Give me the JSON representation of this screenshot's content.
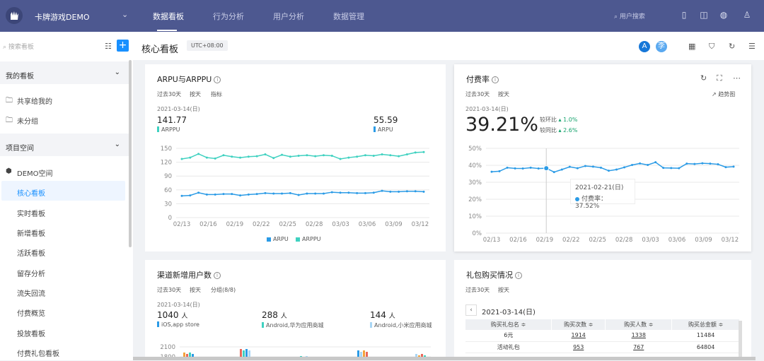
{
  "app": {
    "name": "卡牌游戏DEMO"
  },
  "topnav": {
    "tabs": [
      "数据看板",
      "行为分析",
      "用户分析",
      "数据管理"
    ],
    "search_placeholder": "用户搜索"
  },
  "sidebar": {
    "search_placeholder": "搜索看板",
    "groups": [
      {
        "label": "我的看板"
      },
      {
        "label": "项目空间"
      }
    ],
    "my_items": [
      "共享给我的",
      "未分组"
    ],
    "space_label": "DEMO空间",
    "boards": [
      "核心看板",
      "实时看板",
      "新增看板",
      "活跃看板",
      "留存分析",
      "流失回流",
      "付费概览",
      "投放看板",
      "付费礼包看板"
    ]
  },
  "header": {
    "title": "核心看板",
    "timezone": "UTC+08:00",
    "avatar_a": "A",
    "avatar_b": "李"
  },
  "colors": {
    "topbar": "#4d5890",
    "accent": "#1890ff",
    "arpu": "#2b9be6",
    "arppu": "#3fd1c0",
    "positive": "#13a26b"
  },
  "cards": {
    "arpu": {
      "title": "ARPU与ARPPU",
      "meta": [
        "过去30天",
        "按天",
        "指标"
      ],
      "date": "2021-03-14(日)",
      "val1": "141.77",
      "lab1": "ARPPU",
      "val2": "55.59",
      "lab2": "ARPU",
      "legend": [
        "ARPU",
        "ARPPU"
      ]
    },
    "payrate": {
      "title": "付费率",
      "meta": [
        "过去30天",
        "按天"
      ],
      "trend_label": "趋势图",
      "date": "2021-03-14(日)",
      "value": "39.21%",
      "cmp1_label": "较环比",
      "cmp1_value": "1.0%",
      "cmp2_label": "较同比",
      "cmp2_value": "2.6%",
      "tooltip_date": "2021-02-21(日)",
      "tooltip_label": "付费率：37.52%"
    },
    "channel": {
      "title": "渠道新增用户数",
      "meta": [
        "过去30天",
        "按天",
        "分组(8/8)"
      ],
      "date": "2021-03-14(日)",
      "items": [
        {
          "value": "1040",
          "unit": "人",
          "label": "iOS,app store"
        },
        {
          "value": "288",
          "unit": "人",
          "label": "Android,华为应用商城"
        },
        {
          "value": "144",
          "unit": "人",
          "label": "Android,小米应用商城"
        }
      ]
    },
    "gift": {
      "title": "礼包购买情况",
      "meta": [
        "过去30天",
        "按天"
      ],
      "date": "2021-03-14(日)",
      "headers": [
        "购买礼包名 ≑",
        "购买次数 ≑",
        "购买人数 ≑",
        "购买总金额 ≑"
      ],
      "rows": [
        [
          "6元",
          "1914",
          "1338",
          "11484"
        ],
        [
          "活动礼包",
          "953",
          "767",
          "64804"
        ]
      ]
    }
  },
  "chart_data": [
    {
      "type": "line",
      "title": "ARPU与ARPPU",
      "x_ticks": [
        "02/13",
        "02/16",
        "02/19",
        "02/22",
        "02/25",
        "02/28",
        "03/03",
        "03/06",
        "03/09",
        "03/12"
      ],
      "ylim": [
        0,
        150
      ],
      "y_ticks": [
        "0",
        "30",
        "60",
        "90",
        "120",
        "150"
      ],
      "series": [
        {
          "name": "ARPU",
          "values": [
            47,
            48,
            54,
            50,
            50,
            51,
            51,
            48,
            50,
            51,
            53,
            52,
            52,
            53,
            49,
            52,
            52,
            52,
            55,
            54,
            54,
            53,
            53,
            54,
            58,
            56,
            56,
            57,
            57,
            56
          ]
        },
        {
          "name": "ARPPU",
          "values": [
            127,
            130,
            138,
            130,
            128,
            135,
            132,
            130,
            132,
            133,
            137,
            129,
            136,
            132,
            134,
            135,
            133,
            135,
            134,
            127,
            130,
            132,
            135,
            134,
            137,
            135,
            133,
            137,
            141,
            142
          ]
        }
      ],
      "legend": "bottom"
    },
    {
      "type": "line",
      "title": "付费率",
      "x_ticks": [
        "02/13",
        "02/16",
        "02/19",
        "02/22",
        "02/25",
        "02/28",
        "03/03",
        "03/06",
        "03/09",
        "03/12"
      ],
      "ylim": [
        0,
        50
      ],
      "y_ticks": [
        "0%",
        "10%",
        "20%",
        "30%",
        "40%",
        "50%"
      ],
      "series": [
        {
          "name": "付费率",
          "values": [
            36.2,
            36.5,
            38.6,
            38.2,
            38.1,
            38.6,
            38.1,
            38.3,
            36.0,
            37.5,
            39.1,
            38.3,
            39.6,
            39.2,
            38.6,
            36.8,
            37.5,
            38.8,
            40.2,
            41.1,
            40.2,
            41.8,
            38.5,
            38.4,
            38.3,
            41.0,
            40.8,
            41.2,
            41.0,
            40.6,
            38.9,
            39.2
          ]
        }
      ]
    },
    {
      "type": "bar",
      "title": "渠道新增用户数",
      "y_ticks": [
        "1800",
        "2100"
      ]
    }
  ]
}
